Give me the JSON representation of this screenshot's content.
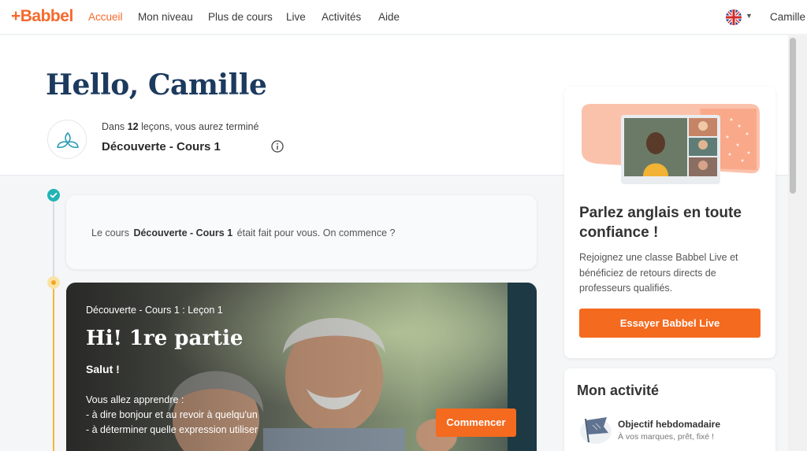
{
  "nav": {
    "logo": "+Babbel",
    "items": [
      "Accueil",
      "Mon niveau",
      "Plus de cours",
      "Live",
      "Activités",
      "Aide"
    ],
    "user": "Camille"
  },
  "hero": {
    "greeting": "Hello, Camille",
    "remain_prefix": "Dans",
    "remain_count": "12",
    "remain_suffix": "leçons, vous aurez terminé",
    "course_name": "Découverte - Cours 1"
  },
  "intro": {
    "prefix": "Le cours",
    "course": "Découverte - Cours 1",
    "suffix": "était fait pour vous. On commence ?"
  },
  "lesson": {
    "crumb": "Découverte - Cours 1 : Leçon 1",
    "title": "Hi! 1re partie",
    "subtitle": "Salut !",
    "learn_heading": "Vous allez apprendre :",
    "learn_items": [
      "- à dire bonjour et au revoir à quelqu'un",
      "- à déterminer quelle expression utiliser"
    ],
    "button": "Commencer"
  },
  "promo": {
    "title": "Parlez anglais en toute confiance !",
    "desc": "Rejoignez une classe Babbel Live et bénéficiez de retours directs de professeurs qualifiés.",
    "button": "Essayer Babbel Live"
  },
  "activity": {
    "title": "Mon activité",
    "goal_title": "Objectif hebdomadaire",
    "goal_sub": "À vos marques, prêt, fixé !"
  },
  "colors": {
    "brand_orange": "#f46a1f",
    "title_navy": "#1c3a5e",
    "done_teal": "#22b3b5",
    "current_amber": "#f5a623"
  }
}
